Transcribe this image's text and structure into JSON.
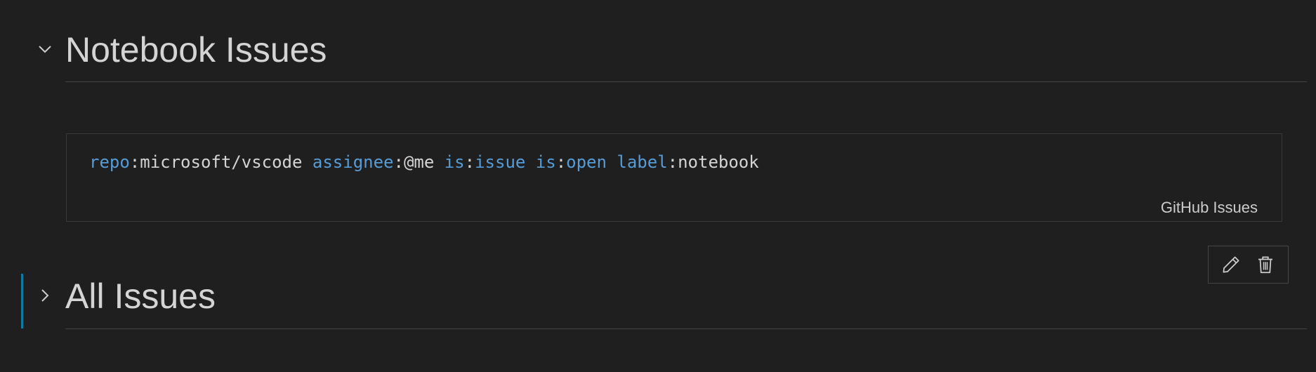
{
  "sections": [
    {
      "title": "Notebook Issues",
      "expanded": true,
      "chevron_icon": "chevron-down-icon"
    },
    {
      "title": "All Issues",
      "expanded": false,
      "chevron_icon": "chevron-right-icon"
    }
  ],
  "code_cell": {
    "tokens": [
      {
        "text": "repo",
        "kind": "key"
      },
      {
        "text": ":",
        "kind": "punct"
      },
      {
        "text": "microsoft/vscode ",
        "kind": "val"
      },
      {
        "text": "assignee",
        "kind": "key"
      },
      {
        "text": ":",
        "kind": "punct"
      },
      {
        "text": "@me ",
        "kind": "val"
      },
      {
        "text": "is",
        "kind": "key"
      },
      {
        "text": ":",
        "kind": "punct"
      },
      {
        "text": "issue ",
        "kind": "key"
      },
      {
        "text": "is",
        "kind": "key"
      },
      {
        "text": ":",
        "kind": "punct"
      },
      {
        "text": "open ",
        "kind": "key"
      },
      {
        "text": "label",
        "kind": "key"
      },
      {
        "text": ":",
        "kind": "punct"
      },
      {
        "text": "notebook",
        "kind": "val"
      }
    ],
    "language_label": "GitHub Issues"
  },
  "toolbar": {
    "edit_icon": "pencil-icon",
    "delete_icon": "trash-icon"
  },
  "colors": {
    "background": "#1f1f1f",
    "keyword": "#569cd6",
    "text": "#d4d4d4",
    "focus_accent": "#0e7aaa"
  }
}
